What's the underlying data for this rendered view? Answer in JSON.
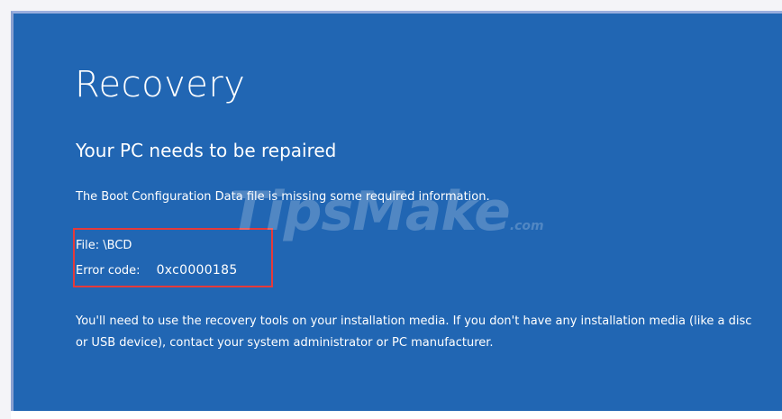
{
  "colors": {
    "background": "#2166b3",
    "text": "#ffffff",
    "highlight": "#e53a3a"
  },
  "recovery": {
    "title": "Recovery",
    "subtitle": "Your PC needs to be repaired",
    "message": "The Boot Configuration Data file is missing some required information.",
    "file_line": "File: \\BCD",
    "error_label": "Error code:",
    "error_code": "0xc0000185",
    "instructions": "You'll need to use the recovery tools on your installation media. If you don't have any installation media (like a disc or USB device), contact your system administrator or PC manufacturer."
  },
  "watermark": {
    "brand": "TipsMake",
    "suffix": ".com"
  }
}
